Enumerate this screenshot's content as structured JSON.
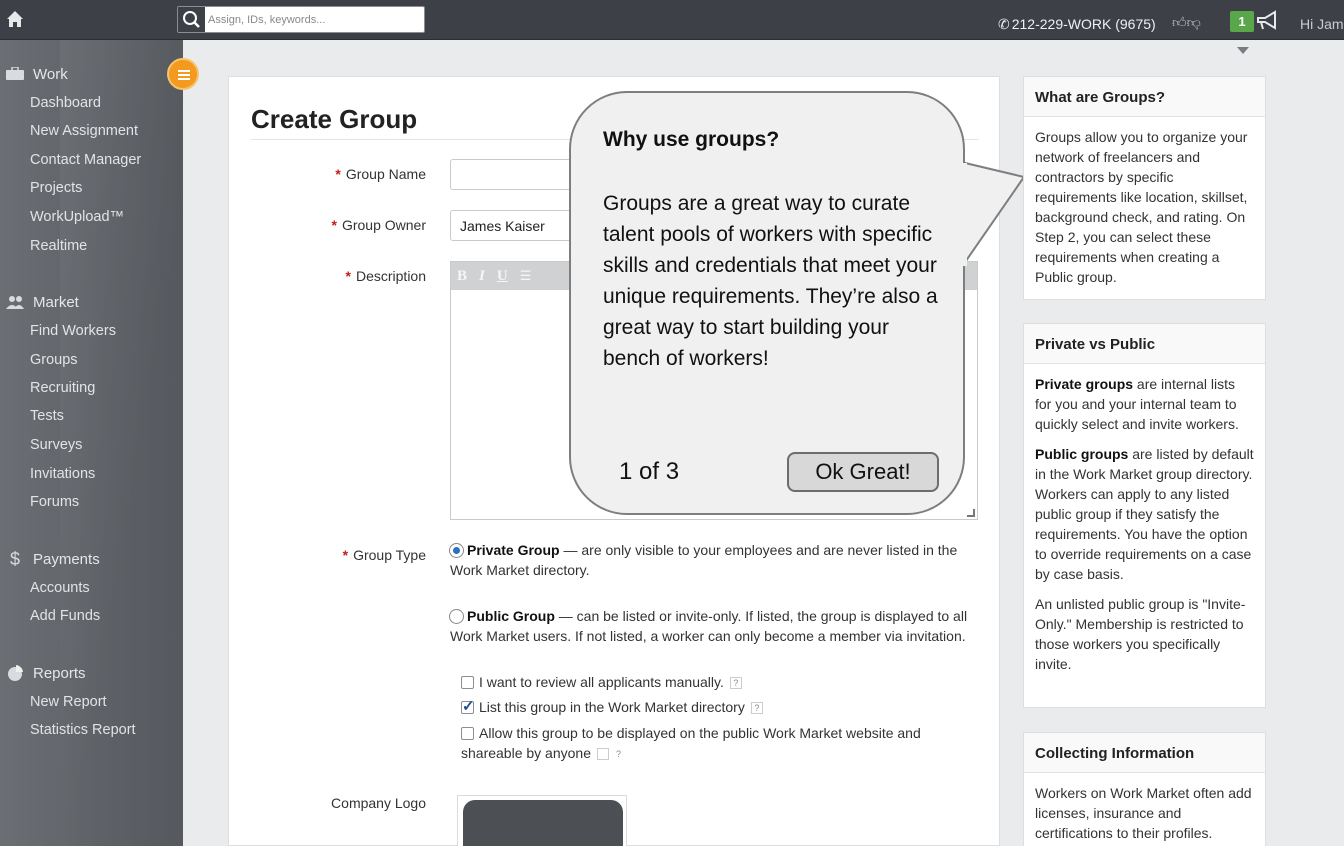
{
  "topbar": {
    "search_placeholder": "Assign, IDs, keywords...",
    "phone": "212-229-WORK (9675)",
    "notification_count": "1",
    "greeting": "Hi Jam"
  },
  "sidebar": {
    "sections": [
      {
        "label": "Work",
        "icon": "briefcase-icon",
        "items": [
          "Dashboard",
          "New Assignment",
          "Contact Manager",
          "Projects",
          "WorkUpload™",
          "Realtime"
        ]
      },
      {
        "label": "Market",
        "icon": "people-icon",
        "items": [
          "Find Workers",
          "Groups",
          "Recruiting",
          "Tests",
          "Surveys",
          "Invitations",
          "Forums"
        ]
      },
      {
        "label": "Payments",
        "icon": "dollar-icon",
        "items": [
          "Accounts",
          "Add Funds"
        ]
      },
      {
        "label": "Reports",
        "icon": "pie-chart-icon",
        "items": [
          "New Report",
          "Statistics Report"
        ]
      }
    ]
  },
  "form": {
    "title": "Create Group",
    "group_name_label": "Group Name",
    "group_name_value": "",
    "group_owner_label": "Group Owner",
    "group_owner_value": "James Kaiser",
    "description_label": "Description",
    "group_type_label": "Group Type",
    "private_title": "Private Group",
    "private_desc": " — are only visible to your employees and are never listed in the Work Market directory.",
    "public_title": "Public Group",
    "public_desc": " — can be listed or invite-only. If listed, the group is displayed to all Work Market users. If not listed, a worker can only become a member via invitation.",
    "checkbox_review": "I want to review all applicants manually.",
    "checkbox_list": "List this group in the Work Market directory",
    "checkbox_public": "Allow this group to be displayed on the public Work Market website and shareable by anyone",
    "company_logo_label": "Company Logo",
    "required_mark": "*",
    "help_mark": "?"
  },
  "tooltip": {
    "title": "Why use groups?",
    "body": "Groups are a great way to curate talent pools of workers with specific skills and credentials that meet your unique requirements. They’re also a great way to start building your bench of workers!",
    "pager": "1 of 3",
    "ok_label": "Ok Great!"
  },
  "panels": {
    "what": {
      "title": "What are Groups?",
      "body": "Groups allow you to organize your network of freelancers and contractors by specific requirements like location, skillset, background check, and rating. On Step 2, you can select these requirements when creating a Public group."
    },
    "private_public": {
      "title": "Private vs Public",
      "p1_bold": "Private groups",
      "p1_rest": " are internal lists for you and your internal team to quickly select and invite workers.",
      "p2_bold": "Public groups",
      "p2_rest": " are listed by default in the Work Market group directory. Workers can apply to any listed public group if they satisfy the requirements. You have the option to override requirements on a case by case basis.",
      "p3": "An unlisted public group is \"Invite-Only.\" Membership is restricted to those workers you specifically invite."
    },
    "collecting": {
      "title": "Collecting Information",
      "body": "Workers on Work Market often add licenses, insurance and certifications to their profiles."
    }
  },
  "colors": {
    "accent": "#f39a1f",
    "topbar": "#3d4147",
    "notif": "#5aa64a",
    "required": "#c0201a"
  }
}
